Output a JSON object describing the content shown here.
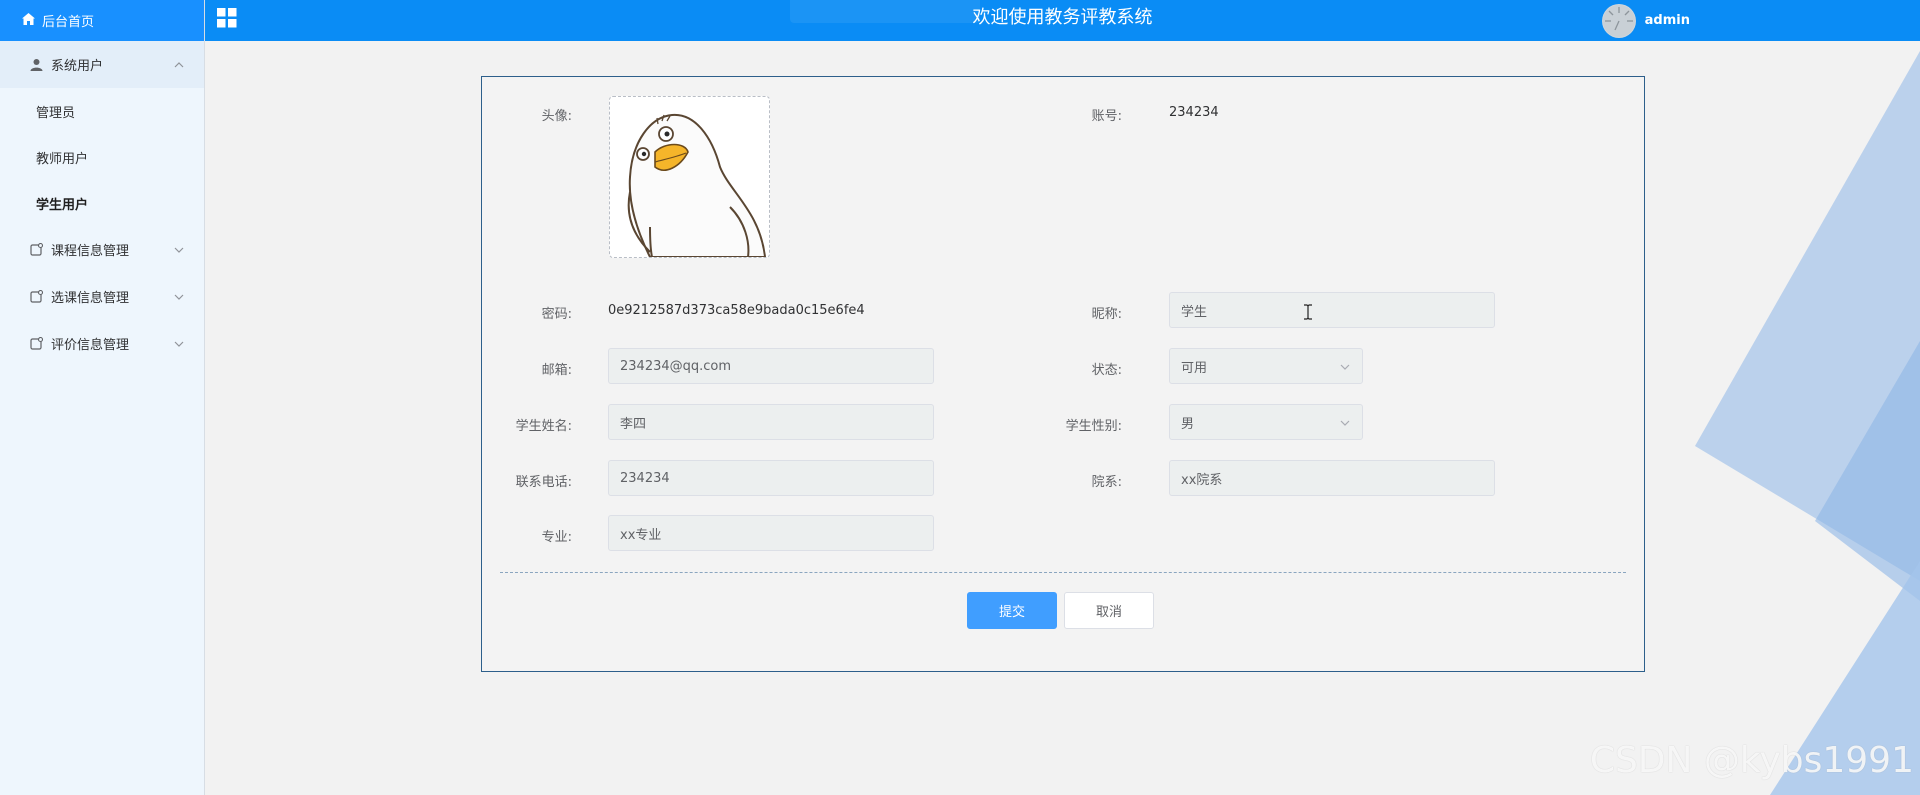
{
  "sidebar": {
    "home_label": "后台首页",
    "groups": [
      {
        "label": "系统用户",
        "expanded": true,
        "items": [
          {
            "label": "管理员",
            "active": false
          },
          {
            "label": "教师用户",
            "active": false
          },
          {
            "label": "学生用户",
            "active": true
          }
        ]
      },
      {
        "label": "课程信息管理",
        "expanded": false
      },
      {
        "label": "选课信息管理",
        "expanded": false
      },
      {
        "label": "评价信息管理",
        "expanded": false
      }
    ]
  },
  "header": {
    "title": "欢迎使用教务评教系统",
    "username": "admin",
    "menu_icon": "grid-icon"
  },
  "form": {
    "avatar_label": "头像:",
    "account_label": "账号:",
    "account_value": "234234",
    "password_label": "密码:",
    "password_value": "0e9212587d373ca58e9bada0c15e6fe4",
    "nickname_label": "昵称:",
    "nickname_value": "学生",
    "email_label": "邮箱:",
    "email_value": "234234@qq.com",
    "status_label": "状态:",
    "status_value": "可用",
    "student_name_label": "学生姓名:",
    "student_name_value": "李四",
    "gender_label": "学生性别:",
    "gender_value": "男",
    "phone_label": "联系电话:",
    "phone_value": "234234",
    "department_label": "院系:",
    "department_value": "xx院系",
    "major_label": "专业:",
    "major_value": "xx专业"
  },
  "buttons": {
    "submit": "提交",
    "cancel": "取消"
  },
  "watermark": "CSDN @kybs1991",
  "colors": {
    "header_bg": "#0a8cf5",
    "home_bg": "#1890ff",
    "primary_button": "#409eff",
    "sidebar_bg": "#eef6fd",
    "card_border": "#2d5f8b"
  }
}
